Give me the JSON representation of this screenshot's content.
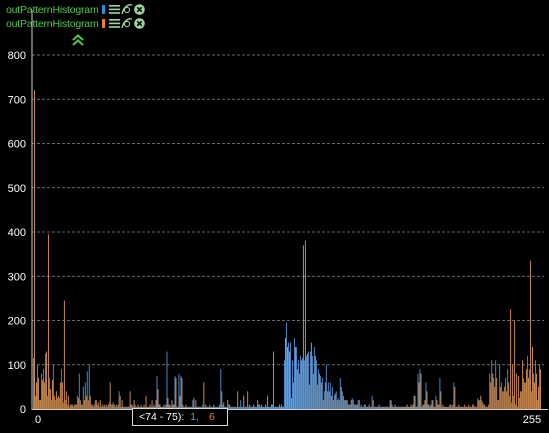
{
  "legend": [
    {
      "label": "outPatternHistogram",
      "color": "#2f8fdc"
    },
    {
      "label": "outPatternHistogram",
      "color": "#ed7d31"
    }
  ],
  "tooltip": {
    "range": "<74 - 75):",
    "value1": "1",
    "separator": ",",
    "value2": "6"
  },
  "colors": {
    "background": "#000000",
    "series1": "#4a86c6",
    "series2": "#c98a4e",
    "grid": "#8a8a8a",
    "text": "#ffffff",
    "legend_text": "#4fc84f"
  },
  "chart_data": {
    "type": "bar",
    "title": "",
    "xlabel": "",
    "ylabel": "",
    "xlim": [
      0,
      255
    ],
    "ylim": [
      0,
      800
    ],
    "x_ticks": [
      "0",
      "255"
    ],
    "y_ticks": [
      "0",
      "100",
      "200",
      "300",
      "400",
      "500",
      "600",
      "700",
      "800"
    ],
    "grid": true,
    "legend_position": "top-left",
    "series": [
      {
        "values": [
          115,
          30,
          100,
          20,
          80,
          90,
          125,
          30,
          70,
          20,
          100,
          20,
          25,
          25,
          90,
          15,
          20,
          10,
          5,
          10,
          5,
          10,
          30,
          80,
          10,
          50,
          60,
          85,
          100,
          10,
          5,
          20,
          10,
          5,
          5,
          5,
          5,
          5,
          15,
          10,
          15,
          5,
          5,
          40,
          5,
          5,
          5,
          5,
          5,
          10,
          5,
          10,
          5,
          5,
          10,
          5,
          5,
          5,
          5,
          5,
          5,
          5,
          75,
          10,
          5,
          5,
          5,
          130,
          10,
          5,
          10,
          75,
          5,
          80,
          75,
          10,
          5,
          5,
          5,
          5,
          20,
          5,
          5,
          5,
          5,
          10,
          5,
          5,
          5,
          5,
          5,
          5,
          5,
          5,
          90,
          10,
          5,
          5,
          10,
          5,
          5,
          5,
          5,
          5,
          20,
          5,
          5,
          5,
          5,
          5,
          5,
          5,
          5,
          10,
          5,
          5,
          5,
          5,
          5,
          5,
          10,
          5,
          5,
          5,
          5,
          5,
          110,
          195,
          150,
          150,
          110,
          160,
          140,
          110,
          120,
          115,
          110,
          120,
          130,
          130,
          120,
          140,
          110,
          90,
          75,
          70,
          40,
          100,
          60,
          60,
          50,
          30,
          40,
          25,
          70,
          40,
          20,
          20,
          10,
          10,
          25,
          10,
          10,
          20,
          5,
          5,
          10,
          5,
          5,
          5,
          30,
          5,
          5,
          5,
          5,
          5,
          5,
          5,
          5,
          20,
          10,
          5,
          5,
          5,
          5,
          5,
          5,
          5,
          5,
          5,
          5,
          30,
          5,
          80,
          90,
          5,
          10,
          60,
          10,
          5,
          20,
          5,
          30,
          10,
          70,
          5,
          5,
          5,
          5,
          10,
          5,
          60,
          5,
          5,
          5,
          5,
          5,
          5,
          5,
          5,
          5,
          10,
          5,
          25,
          20,
          20,
          10,
          5,
          5,
          80,
          110,
          70,
          110,
          20,
          100,
          60,
          40,
          70,
          90,
          30,
          15,
          30,
          10,
          5,
          25,
          40,
          70,
          60,
          120,
          90,
          40,
          80,
          110,
          20,
          100
        ]
      },
      {
        "values": [
          720,
          60,
          70,
          20,
          65,
          60,
          130,
          395,
          45,
          65,
          30,
          40,
          30,
          60,
          60,
          245,
          40,
          30,
          10,
          10,
          10,
          10,
          25,
          20,
          10,
          20,
          30,
          20,
          30,
          10,
          10,
          20,
          15,
          20,
          10,
          10,
          10,
          10,
          60,
          10,
          10,
          10,
          10,
          30,
          20,
          5,
          5,
          5,
          40,
          10,
          20,
          5,
          10,
          5,
          5,
          10,
          30,
          5,
          10,
          20,
          10,
          20,
          45,
          10,
          5,
          10,
          10,
          25,
          10,
          20,
          10,
          70,
          5,
          30,
          70,
          5,
          10,
          5,
          5,
          5,
          25,
          20,
          5,
          5,
          5,
          60,
          10,
          5,
          10,
          5,
          10,
          5,
          5,
          10,
          40,
          15,
          5,
          20,
          10,
          5,
          5,
          5,
          40,
          5,
          5,
          30,
          5,
          40,
          10,
          5,
          10,
          5,
          20,
          10,
          10,
          5,
          10,
          30,
          5,
          10,
          130,
          5,
          5,
          10,
          10,
          5,
          160,
          140,
          130,
          25,
          60,
          140,
          90,
          80,
          110,
          370,
          380,
          125,
          55,
          150,
          80,
          120,
          55,
          80,
          60,
          20,
          60,
          40,
          40,
          30,
          20,
          35,
          20,
          20,
          50,
          30,
          20,
          20,
          10,
          20,
          20,
          10,
          10,
          20,
          10,
          5,
          10,
          5,
          10,
          5,
          20,
          5,
          5,
          10,
          5,
          5,
          5,
          5,
          5,
          20,
          5,
          10,
          5,
          5,
          5,
          5,
          5,
          10,
          5,
          10,
          10,
          30,
          5,
          60,
          80,
          10,
          20,
          40,
          10,
          10,
          20,
          5,
          20,
          10,
          40,
          10,
          5,
          5,
          5,
          10,
          10,
          50,
          5,
          10,
          5,
          5,
          10,
          5,
          10,
          5,
          10,
          5,
          5,
          20,
          30,
          15,
          10,
          5,
          10,
          60,
          80,
          50,
          70,
          20,
          50,
          40,
          50,
          40,
          60,
          225,
          100,
          200,
          80,
          75,
          40,
          110,
          60,
          90,
          70,
          335,
          140,
          60,
          80,
          50,
          90
        ]
      }
    ]
  }
}
